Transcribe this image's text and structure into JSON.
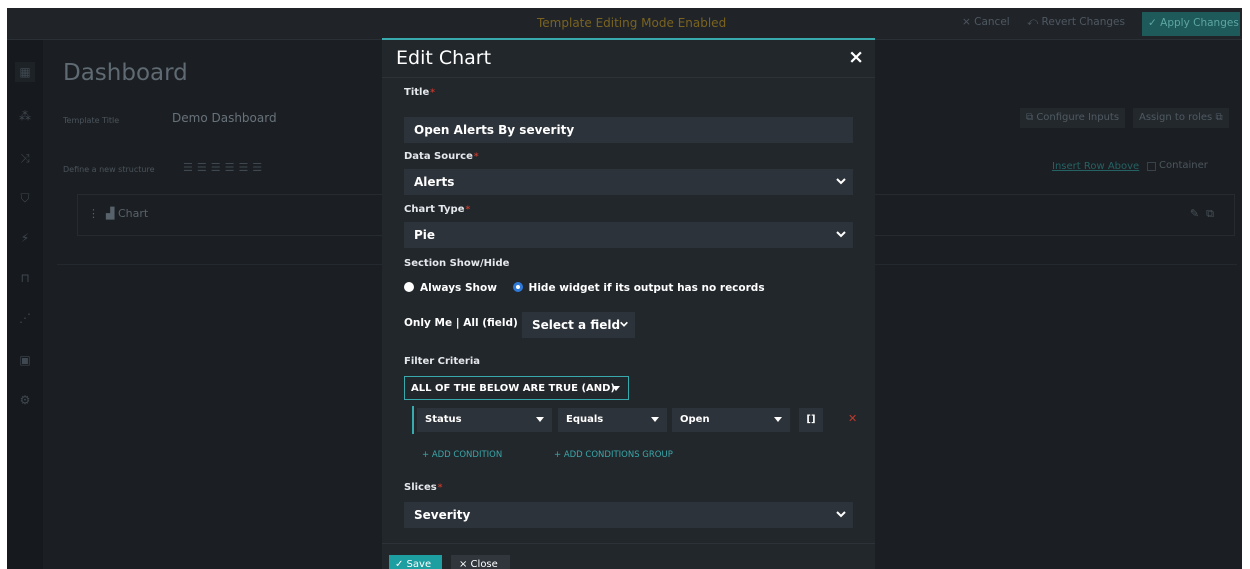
{
  "topbar": {
    "mode_text": "Template Editing Mode Enabled",
    "cancel": "× Cancel",
    "revert": "⤺ Revert Changes",
    "apply": "✓ Apply Changes"
  },
  "page": {
    "title": "Dashboard",
    "template_title_label": "Template Title",
    "template_title_value": "Demo Dashboard",
    "configure_inputs": "⧉ Configure Inputs",
    "assign_roles": "Assign to roles ⧉",
    "structure_label": "Define a new structure",
    "insert_row": "Insert Row Above",
    "container": "Container",
    "widget_label": "Chart"
  },
  "modal": {
    "title": "Edit Chart",
    "close_icon": "×",
    "title_label": "Title",
    "title_value": "Open Alerts By severity",
    "datasource_label": "Data Source",
    "datasource_value": "Alerts",
    "charttype_label": "Chart Type",
    "charttype_value": "Pie",
    "section_label": "Section Show/Hide",
    "radio_always": "Always Show",
    "radio_hide": "Hide widget if its output has no records",
    "only_me_label": "Only Me | All (field) :",
    "only_me_select": "Select a field",
    "filter_label": "Filter Criteria",
    "logic_value": "ALL OF THE BELOW ARE TRUE (AND)",
    "condition": {
      "field": "Status",
      "operator": "Equals",
      "value": "Open",
      "brackets": "[]"
    },
    "add_condition": "+ ADD CONDITION",
    "add_group": "+ ADD CONDITIONS GROUP",
    "slices_label": "Slices",
    "slices_value": "Severity",
    "save_button": "✓ Save",
    "close_button": "× Close"
  },
  "icons": {
    "chevron": "chevron-down-icon",
    "caret": "caret-down-icon"
  },
  "colors": {
    "accent": "#38a9ad",
    "required": "#c0392b",
    "radio_selected": "#2f7ad9"
  }
}
